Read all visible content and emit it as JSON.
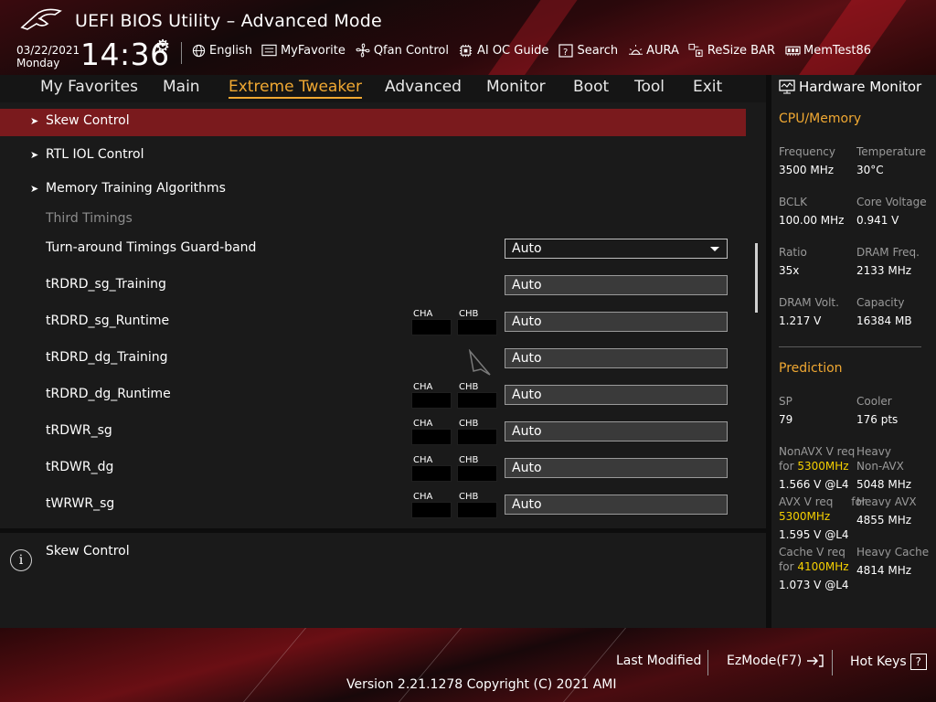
{
  "header": {
    "title": "UEFI BIOS Utility – Advanced Mode",
    "date": "03/22/2021",
    "day": "Monday",
    "time": "14:36",
    "toolbar": [
      {
        "label": "English",
        "icon": "globe-icon"
      },
      {
        "label": "MyFavorite",
        "icon": "favorite-list-icon"
      },
      {
        "label": "Qfan Control",
        "icon": "fan-icon"
      },
      {
        "label": "AI OC Guide",
        "icon": "chip-icon"
      },
      {
        "label": "Search",
        "icon": "search-question-icon"
      },
      {
        "label": "AURA",
        "icon": "aura-light-icon"
      },
      {
        "label": "ReSize BAR",
        "icon": "resize-bar-icon"
      },
      {
        "label": "MemTest86",
        "icon": "memory-icon"
      }
    ]
  },
  "nav": {
    "tabs": [
      "My Favorites",
      "Main",
      "Extreme Tweaker",
      "Advanced",
      "Monitor",
      "Boot",
      "Tool",
      "Exit"
    ],
    "active": "Extreme Tweaker"
  },
  "main": {
    "submenus": [
      "Skew Control",
      "RTL IOL Control",
      "Memory Training Algorithms"
    ],
    "section_title": "Third Timings",
    "items": [
      {
        "label": "Turn-around Timings Guard-band",
        "value": "Auto",
        "type": "dropdown",
        "channels": false
      },
      {
        "label": "tRDRD_sg_Training",
        "value": "Auto",
        "type": "field",
        "channels": false
      },
      {
        "label": "tRDRD_sg_Runtime",
        "value": "Auto",
        "type": "field",
        "channels": true
      },
      {
        "label": "tRDRD_dg_Training",
        "value": "Auto",
        "type": "field",
        "channels": false
      },
      {
        "label": "tRDRD_dg_Runtime",
        "value": "Auto",
        "type": "field",
        "channels": true
      },
      {
        "label": "tRDWR_sg",
        "value": "Auto",
        "type": "field",
        "channels": true
      },
      {
        "label": "tRDWR_dg",
        "value": "Auto",
        "type": "field",
        "channels": true
      },
      {
        "label": "tWRWR_sg",
        "value": "Auto",
        "type": "field",
        "channels": true
      }
    ],
    "channel_a": "CHA",
    "channel_b": "CHB"
  },
  "help": {
    "text": "Skew Control"
  },
  "hardware_monitor": {
    "title": "Hardware Monitor",
    "cpu_memory": {
      "title": "CPU/Memory",
      "frequency_label": "Frequency",
      "frequency": "3500 MHz",
      "temperature_label": "Temperature",
      "temperature": "30°C",
      "bclk_label": "BCLK",
      "bclk": "100.00 MHz",
      "core_voltage_label": "Core Voltage",
      "core_voltage": "0.941 V",
      "ratio_label": "Ratio",
      "ratio": "35x",
      "dram_freq_label": "DRAM Freq.",
      "dram_freq": "2133 MHz",
      "dram_volt_label": "DRAM Volt.",
      "dram_volt": "1.217 V",
      "capacity_label": "Capacity",
      "capacity": "16384 MB"
    },
    "prediction": {
      "title": "Prediction",
      "sp_label": "SP",
      "sp": "79",
      "cooler_label": "Cooler",
      "cooler": "176 pts",
      "nonavx_label": "NonAVX V req",
      "nonavx_for": "for",
      "nonavx_freq": "5300MHz",
      "nonavx_value": "1.566 V @L4",
      "heavy_nonavx_label_1": "Heavy",
      "heavy_nonavx_label_2": "Non-AVX",
      "heavy_nonavx_value": "5048 MHz",
      "avx_label": "AVX V req",
      "avx_for": "for",
      "avx_freq": "5300MHz",
      "avx_value": "1.595 V @L4",
      "heavy_avx_label": "Heavy AVX",
      "heavy_avx_value": "4855 MHz",
      "cache_label": "Cache V req",
      "cache_for": "for",
      "cache_freq": "4100MHz",
      "cache_value": "1.073 V @L4",
      "heavy_cache_label": "Heavy Cache",
      "heavy_cache_value": "4814 MHz"
    }
  },
  "footer": {
    "last_modified": "Last Modified",
    "ezmode": "EzMode(F7)",
    "hot_keys": "Hot Keys",
    "hot_keys_symbol": "?",
    "version": "Version 2.21.1278 Copyright (C) 2021 AMI"
  },
  "colors": {
    "accent": "#f0a832",
    "highlight_row": "#7a1a1d",
    "prediction_freq": "#f5d000"
  }
}
